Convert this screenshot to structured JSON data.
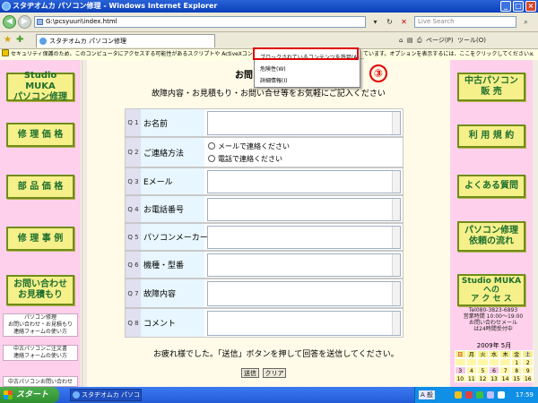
{
  "window": {
    "title": "スタヂオムカ パソコン修理 - Windows Internet Explorer"
  },
  "address": {
    "url": "G:\\pcsyuuri\\index.html",
    "search_placeholder": "Live Search"
  },
  "tab": {
    "label": "スタヂオムカ パソコン修理"
  },
  "toolbar": {
    "page_label": "ページ(P)",
    "tools_label": "ツール(O)"
  },
  "infobar": {
    "text_left": "セキュリティ保護のため、このコンピュータにアクセスする可能性があるスクリプトや ActiveXコントロール",
    "text_right": "ています。オプションを表示するには、ここをクリックしてください..."
  },
  "dropdown": {
    "items": [
      "ブロックされているコンテンツを許可(A)...",
      "危険性(W)",
      "詳細情報(I)"
    ]
  },
  "annotation": {
    "number": "③"
  },
  "left_nav": [
    "Studio MUKA\nパソコン修理",
    "修 理 価 格",
    "部 品 価 格",
    "修 理 事 例",
    "お問い合わせ\nお見積もり"
  ],
  "left_notes": [
    "パソコン修理\nお問い合わせ・お見積もり\n連絡フォームの使い方",
    "中古パソコンご注文書\n連絡フォームの使い方",
    "中古パソコンお問い合わせ"
  ],
  "right_nav": [
    "中古パソコン\n販 売",
    "利 用 規 約",
    "よくある質問",
    "パソコン修理\n依頼の流れ",
    "Studio MUKA\nへの\nア ク セ ス"
  ],
  "right_contact": "Tel080-3823-6893\n営業時間 10:00～19:00\nお問い合わせメール\nは24時間受付中",
  "form": {
    "title": "お問い合わせ・お",
    "intro": "故障内容・お見積もり・お問い合せ等をお気軽にご記入ください",
    "questions": [
      {
        "num": "Q 1",
        "label": "お名前"
      },
      {
        "num": "Q 2",
        "label": "ご連絡方法"
      },
      {
        "num": "Q 3",
        "label": "Eメール"
      },
      {
        "num": "Q 4",
        "label": "お電話番号"
      },
      {
        "num": "Q 5",
        "label": "パソコンメーカー"
      },
      {
        "num": "Q 6",
        "label": "機種・型番"
      },
      {
        "num": "Q 7",
        "label": "故障内容"
      },
      {
        "num": "Q 8",
        "label": "コメント"
      }
    ],
    "contact_options": [
      "メールで連絡ください",
      "電話で連絡ください"
    ],
    "closing": "お疲れ様でした。「送信」ボタンを押して回答を送信してください。",
    "submit_label": "送信",
    "clear_label": "クリア"
  },
  "calendar": {
    "title": "2009年 5月",
    "weekdays": [
      "日",
      "月",
      "火",
      "水",
      "木",
      "金",
      "土"
    ],
    "rows": [
      [
        "",
        "",
        "",
        "",
        "",
        "1",
        "2"
      ],
      [
        "3",
        "4",
        "5",
        "6",
        "7",
        "8",
        "9"
      ],
      [
        "10",
        "11",
        "12",
        "13",
        "14",
        "15",
        "16"
      ]
    ]
  },
  "taskbar": {
    "start_label": "スタート",
    "task_label": "スタヂオムカ パソコン...",
    "ime_label": "A 般",
    "clock": "17:59"
  },
  "colors": {
    "highlight": "#e00000",
    "nav_text": "#1e6f2e",
    "nav_bg": "#f6f08a",
    "side_bg": "#ffd0ec"
  }
}
